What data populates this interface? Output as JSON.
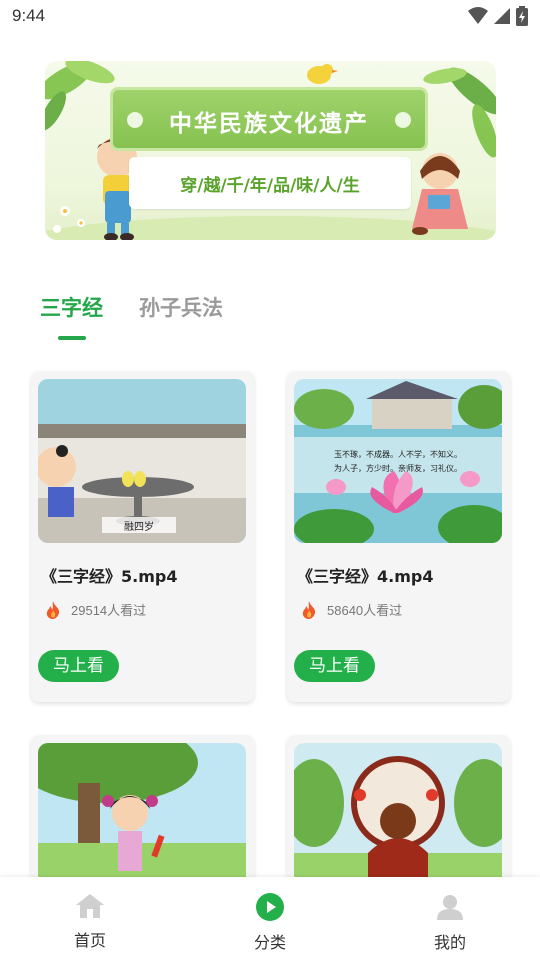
{
  "status_bar": {
    "time": "9:44",
    "icons": [
      "wifi-icon",
      "signal-icon",
      "battery-icon"
    ]
  },
  "banner": {
    "title": "中华民族文化遗产",
    "subtitle": "穿/越/千/年/品/味/人/生"
  },
  "tabs": [
    {
      "label": "三字经",
      "active": true
    },
    {
      "label": "孙子兵法",
      "active": false
    }
  ],
  "videos": [
    {
      "title": "《三字经》5.mp4",
      "views": "29514人看过",
      "button": "马上看",
      "thumb_caption": "融四岁"
    },
    {
      "title": "《三字经》4.mp4",
      "views": "58640人看过",
      "button": "马上看",
      "thumb_text_1": "玉不琢，不成器。人不学，不知义。",
      "thumb_text_2": "为人子，方少时。亲师友，习礼仪。"
    },
    {
      "title": "",
      "views": "",
      "button": ""
    },
    {
      "title": "",
      "views": "",
      "button": ""
    }
  ],
  "bottom_nav": [
    {
      "label": "首页",
      "icon": "home-icon",
      "active": false
    },
    {
      "label": "分类",
      "icon": "play-icon",
      "active": true
    },
    {
      "label": "我的",
      "icon": "user-icon",
      "active": false
    }
  ],
  "colors": {
    "accent": "#23a74a",
    "inactive_tab": "#9a9a9a",
    "fire": "#f05a2a"
  }
}
